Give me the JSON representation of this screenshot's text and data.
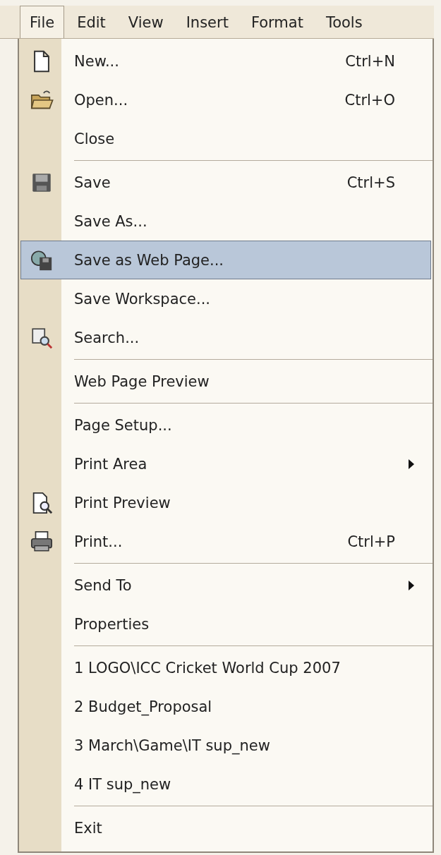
{
  "menu_bar": [
    {
      "label": "File",
      "selected": true
    },
    {
      "label": "Edit",
      "selected": false
    },
    {
      "label": "View",
      "selected": false
    },
    {
      "label": "Insert",
      "selected": false
    },
    {
      "label": "Format",
      "selected": false
    },
    {
      "label": "Tools",
      "selected": false
    }
  ],
  "menu": [
    {
      "kind": "item",
      "label": "New...",
      "shortcut": "Ctrl+N",
      "submenu": false,
      "selected": false
    },
    {
      "kind": "item",
      "label": "Open...",
      "shortcut": "Ctrl+O",
      "submenu": false,
      "selected": false
    },
    {
      "kind": "item",
      "label": "Close",
      "submenu": false,
      "selected": false
    },
    {
      "kind": "separator"
    },
    {
      "kind": "item",
      "label": "Save",
      "shortcut": "Ctrl+S",
      "submenu": false,
      "selected": false
    },
    {
      "kind": "item",
      "label": "Save As...",
      "submenu": false,
      "selected": false
    },
    {
      "kind": "item",
      "label": "Save as Web Page...",
      "submenu": false,
      "selected": true
    },
    {
      "kind": "item",
      "label": "Save Workspace...",
      "submenu": false,
      "selected": false
    },
    {
      "kind": "item",
      "label": "Search...",
      "submenu": false,
      "selected": false
    },
    {
      "kind": "separator"
    },
    {
      "kind": "item",
      "label": "Web Page Preview",
      "submenu": false,
      "selected": false
    },
    {
      "kind": "separator"
    },
    {
      "kind": "item",
      "label": "Page Setup...",
      "submenu": false,
      "selected": false
    },
    {
      "kind": "item",
      "label": "Print Area",
      "submenu": true,
      "selected": false
    },
    {
      "kind": "item",
      "label": "Print Preview",
      "submenu": false,
      "selected": false
    },
    {
      "kind": "item",
      "label": "Print...",
      "shortcut": "Ctrl+P",
      "submenu": false,
      "selected": false
    },
    {
      "kind": "separator"
    },
    {
      "kind": "item",
      "label": "Send To",
      "submenu": true,
      "selected": false
    },
    {
      "kind": "item",
      "label": "Properties",
      "submenu": false,
      "selected": false
    },
    {
      "kind": "separator"
    },
    {
      "kind": "item",
      "label": "1 LOGO\\ICC Cricket World Cup 2007",
      "submenu": false,
      "selected": false
    },
    {
      "kind": "item",
      "label": "2 Budget_Proposal",
      "submenu": false,
      "selected": false
    },
    {
      "kind": "item",
      "label": "3 March\\Game\\IT sup_new",
      "submenu": false,
      "selected": false
    },
    {
      "kind": "item",
      "label": "4 IT sup_new",
      "submenu": false,
      "selected": false
    },
    {
      "kind": "separator"
    },
    {
      "kind": "item",
      "label": "Exit",
      "submenu": false,
      "selected": false
    }
  ]
}
